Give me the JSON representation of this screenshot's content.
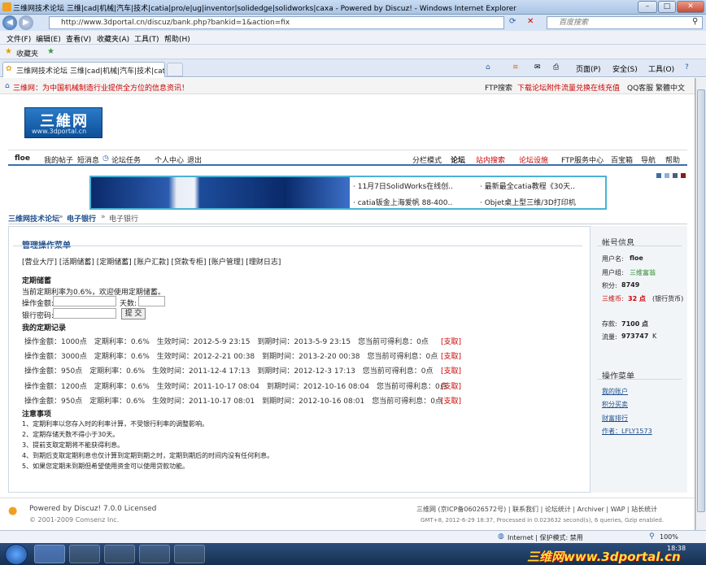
{
  "window": {
    "title": "三维网技术论坛 三维|cad|机械|汽车|技术|catia|pro/e|ug|inventor|solidedge|solidworks|caxa - Powered by Discuz! - Windows Internet Explorer",
    "min": "–",
    "max": "□",
    "close": "✕"
  },
  "addressbar": {
    "url": "http://www.3dportal.cn/discuz/bank.php?bankid=1&action=fix",
    "search_placeholder": "百度搜索"
  },
  "menu": [
    "文件(F)",
    "编辑(E)",
    "查看(V)",
    "收藏夹(A)",
    "工具(T)",
    "帮助(H)"
  ],
  "favorites": {
    "label": "收藏夹"
  },
  "tab": {
    "label": "三维网技术论坛 三维|cad|机械|汽车|技术|catia|p..."
  },
  "toolbar": {
    "page": "页面(P)",
    "safety": "安全(S)",
    "tools": "工具(O)"
  },
  "page": {
    "top_slogan": "三维网：为中国机械制造行业提供全方位的信息资讯！",
    "top_links": [
      "FTP搜索",
      "下载论坛附件流量兑换",
      "在线充值",
      "QQ客服",
      "繁體中文"
    ],
    "logo": {
      "main": "三維网",
      "sub": "www.3dportal.cn"
    },
    "nav_left": [
      "floe",
      "我的帖子",
      "短消息",
      "论坛任务",
      "个人中心",
      "退出"
    ],
    "nav_right": [
      "分栏模式",
      "论坛",
      "站内搜索",
      "论坛设施",
      "FTP服务中心",
      "百宝箱",
      "导航",
      "帮助"
    ],
    "ads": [
      "· 11月7日SolidWorks在线创..",
      "· 最新最全catia教程《30天..",
      "· catia钣金上海爱帆 88-400..",
      "· Objet桌上型三维/3D打印机"
    ],
    "breadcrumb": [
      "三维网技术论坛",
      "电子银行",
      "电子银行"
    ],
    "main": {
      "menu_title": "管理操作菜单",
      "menu_links": "[营业大厅] [活期储蓄] [定期储蓄] [账户汇款] [贷款专柜] [账户管理] [理财日志]",
      "fixed_title": "定期储蓄",
      "fixed_desc": "当前定期利率为0.6%，欢迎使用定期储蓄。",
      "amount_label": "操作金额:",
      "days_label": "天数:",
      "password_label": "银行密码:",
      "submit": "提 交",
      "records_title": "我的定期记录",
      "records": [
        {
          "text": "操作金额：1000点　定期利率：0.6%　生效时间：2012-5-9 23:15　到期时间：2013-5-9 23:15　您当前可得利息：0点",
          "action": "[支取]"
        },
        {
          "text": "操作金额：3000点　定期利率：0.6%　生效时间：2012-2-21 00:38　到期时间：2013-2-20 00:38　您当前可得利息：0点",
          "action": "[支取]"
        },
        {
          "text": "操作金额：950点　定期利率：0.6%　生效时间：2011-12-4 17:13　到期时间：2012-12-3 17:13　您当前可得利息：0点",
          "action": "[支取]"
        },
        {
          "text": "操作金额：1200点　定期利率：0.6%　生效时间：2011-10-17 08:04　到期时间：2012-10-16 08:04　您当前可得利息：0点",
          "action": "[支取]"
        },
        {
          "text": "操作金额：950点　定期利率：0.6%　生效时间：2011-10-17 08:01　到期时间：2012-10-16 08:01　您当前可得利息：0点",
          "action": "[支取]"
        }
      ],
      "notes_title": "注意事项",
      "notes": [
        "1、定期利率以您存入时的利率计算，不受银行利率的调整影响。",
        "2、定期存储天数不得小于30天。",
        "3、提前支取定期将不能获得利息。",
        "4、到期后支取定期利息也仅计算到定期到期之时，定期到期后的时间内没有任何利息。",
        "5、如果您定期未到期但希望使用资金可以使用贷款功能。"
      ]
    },
    "sidebar": {
      "account_title": "帐号信息",
      "user_label": "用户名:",
      "user": "floe",
      "group_label": "用户组:",
      "group": "三维富翁",
      "points_label": "积分:",
      "points": "8749",
      "coins_label": "三维币:",
      "coins": "32 点",
      "coins_suffix": "(银行货币)",
      "deposit_label": "存款:",
      "deposit": "7100 点",
      "traffic_label": "流量:",
      "traffic": "973747",
      "traffic_unit": "K",
      "ops_title": "操作菜单",
      "ops": [
        "我的账户",
        "积分买卖",
        "财富排行",
        "作者：LFLY1573"
      ]
    },
    "footer": {
      "powered": "Powered by Discuz! 7.0.0 Licensed",
      "copyright": "© 2001-2009 Comsenz Inc.",
      "links": "三维网 (京ICP备06026572号) | 联系我们 | 论坛统计 | Archiver | WAP | 站长统计",
      "info": "GMT+8, 2012-6-29 18:37, Processed in 0.023632 second(s), 6 queries, Gzip enabled."
    }
  },
  "statusbar": {
    "zone": "Internet | 保护模式: 禁用",
    "zoom": "100%"
  },
  "taskbar": {
    "time": "18:38",
    "watermark": "三维网www.3dportal.cn"
  }
}
